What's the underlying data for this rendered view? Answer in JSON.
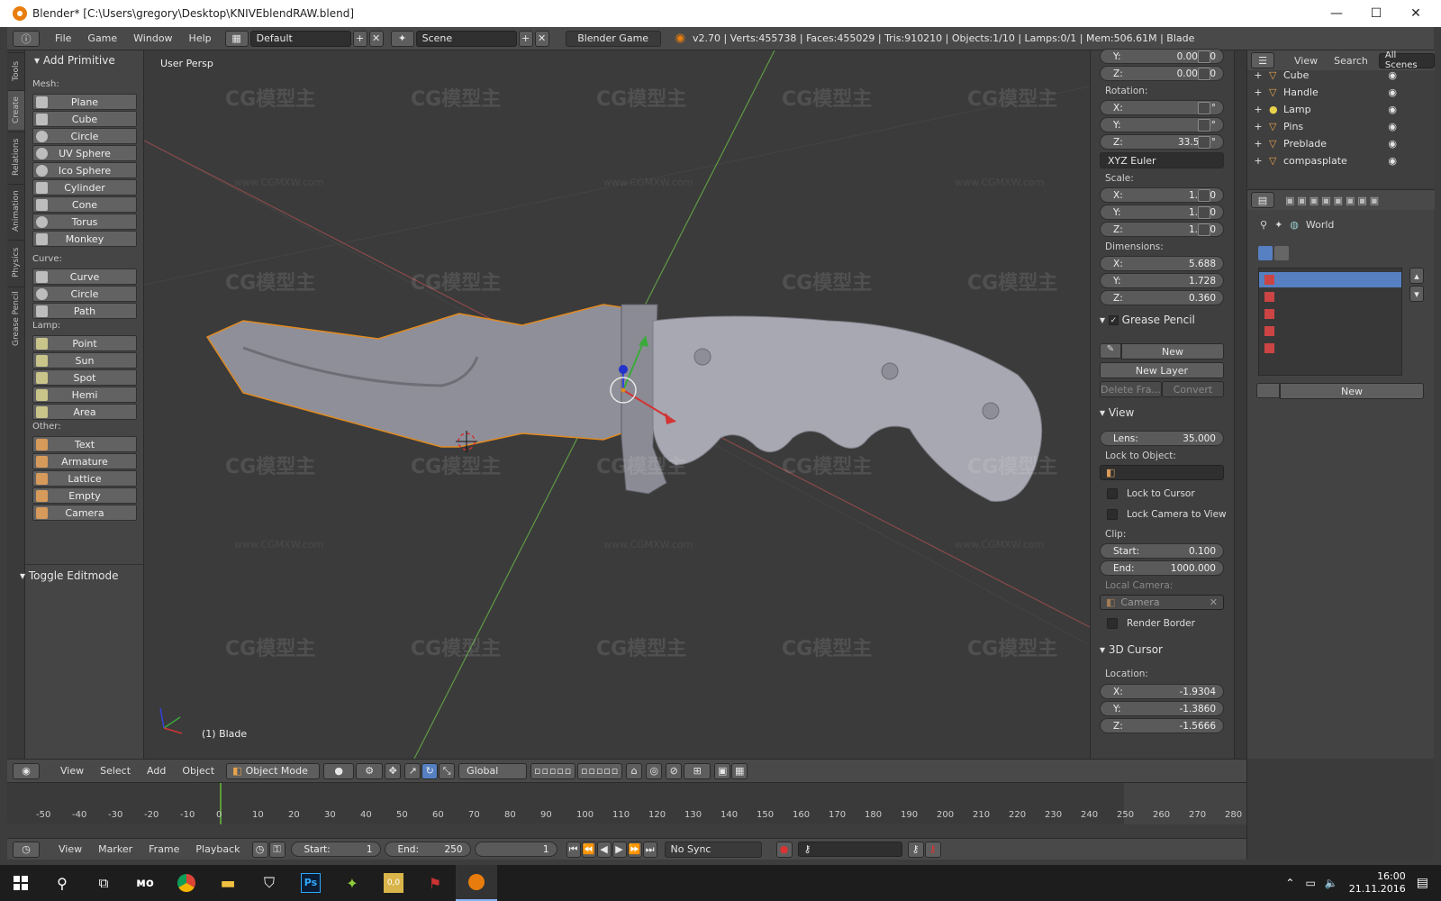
{
  "window": {
    "title": "Blender* [C:\\Users\\gregory\\Desktop\\KNIVEblendRAW.blend]",
    "minimize": "—",
    "maximize": "☐",
    "close": "✕"
  },
  "header": {
    "menus": [
      "File",
      "Game",
      "Window",
      "Help"
    ],
    "layout": "Default",
    "scene": "Scene",
    "engine": "Blender Game",
    "stats": "v2.70 | Verts:455738 | Faces:455029 | Tris:910210 | Objects:1/10 | Lamps:0/1 | Mem:506.61M | Blade"
  },
  "tool_tabs": [
    "Tools",
    "Create",
    "Relations",
    "Animation",
    "Physics",
    "Grease Pencil"
  ],
  "shelf": {
    "title": "Add Primitive",
    "mesh_label": "Mesh:",
    "mesh": [
      "Plane",
      "Cube",
      "Circle",
      "UV Sphere",
      "Ico Sphere",
      "Cylinder",
      "Cone",
      "Torus",
      "Monkey"
    ],
    "curve_label": "Curve:",
    "curve": [
      "Curve",
      "Circle",
      "Path"
    ],
    "lamp_label": "Lamp:",
    "lamp": [
      "Point",
      "Sun",
      "Spot",
      "Hemi",
      "Area"
    ],
    "other_label": "Other:",
    "other": [
      "Text",
      "Armature",
      "Lattice",
      "Empty",
      "Camera"
    ],
    "toggle_editmode": "Toggle Editmode"
  },
  "viewport": {
    "view_name": "User Persp",
    "object_label": "(1) Blade",
    "watermark": "CG模型主",
    "watermark_url": "www.CGMXW.com"
  },
  "properties": {
    "loc_y": {
      "label": "Y:",
      "value": "0.00000"
    },
    "loc_z": {
      "label": "Z:",
      "value": "0.00000"
    },
    "rotation_label": "Rotation:",
    "rot": [
      {
        "label": "X:",
        "value": "0°"
      },
      {
        "label": "Y:",
        "value": "0°"
      },
      {
        "label": "Z:",
        "value": "33.594°"
      }
    ],
    "rotation_mode": "XYZ Euler",
    "scale_label": "Scale:",
    "scale": [
      {
        "label": "X:",
        "value": "1.000"
      },
      {
        "label": "Y:",
        "value": "1.000"
      },
      {
        "label": "Z:",
        "value": "1.000"
      }
    ],
    "dimensions_label": "Dimensions:",
    "dimensions": [
      {
        "label": "X:",
        "value": "5.688"
      },
      {
        "label": "Y:",
        "value": "1.728"
      },
      {
        "label": "Z:",
        "value": "0.360"
      }
    ],
    "grease_pencil": "Grease Pencil",
    "gp_new": "New",
    "gp_new_layer": "New Layer",
    "gp_delete_frame": "Delete Fra...",
    "gp_convert": "Convert",
    "view_section": "View",
    "lens": {
      "label": "Lens:",
      "value": "35.000"
    },
    "lock_to_object": "Lock to Object:",
    "lock_to_cursor": "Lock to Cursor",
    "lock_camera_to_view": "Lock Camera to View",
    "clip_label": "Clip:",
    "clip_start": {
      "label": "Start:",
      "value": "0.100"
    },
    "clip_end": {
      "label": "End:",
      "value": "1000.000"
    },
    "local_camera": "Local Camera:",
    "camera": "Camera",
    "render_border": "Render Border",
    "cursor_section": "3D Cursor",
    "location_label": "Location:",
    "cursor": [
      {
        "label": "X:",
        "value": "-1.9304"
      },
      {
        "label": "Y:",
        "value": "-1.3860"
      },
      {
        "label": "Z:",
        "value": "-1.5666"
      }
    ]
  },
  "outliner": {
    "view": "View",
    "search": "Search",
    "all_scenes": "All Scenes",
    "items": [
      "Cube",
      "Handle",
      "Lamp",
      "Pins",
      "Preblade",
      "compasplate"
    ]
  },
  "world_panel": {
    "world": "World",
    "new": "New"
  },
  "view3d_header": {
    "menus": [
      "View",
      "Select",
      "Add",
      "Object"
    ],
    "mode": "Object Mode",
    "orientation": "Global"
  },
  "timeline": {
    "ticks": [
      "-50",
      "-40",
      "-30",
      "-20",
      "-10",
      "0",
      "10",
      "20",
      "30",
      "40",
      "50",
      "60",
      "70",
      "80",
      "90",
      "100",
      "110",
      "120",
      "130",
      "140",
      "150",
      "160",
      "170",
      "180",
      "190",
      "200",
      "210",
      "220",
      "230",
      "240",
      "250",
      "260",
      "270",
      "280"
    ],
    "menus": [
      "View",
      "Marker",
      "Frame",
      "Playback"
    ],
    "start": {
      "label": "Start:",
      "value": "1"
    },
    "end": {
      "label": "End:",
      "value": "250"
    },
    "current": "1",
    "sync": "No Sync"
  },
  "taskbar": {
    "time": "16:00",
    "date": "21.11.2016",
    "apps": [
      "start-icon",
      "search-icon",
      "task-view-icon",
      "mo-icon",
      "chrome-icon",
      "explorer-icon",
      "store-icon",
      "photoshop-icon",
      "game-icon",
      "notes-icon",
      "flag-icon",
      "blender-icon"
    ],
    "ps_label": "Ps",
    "mo_label": "мо",
    "notes_label": "0,0"
  }
}
